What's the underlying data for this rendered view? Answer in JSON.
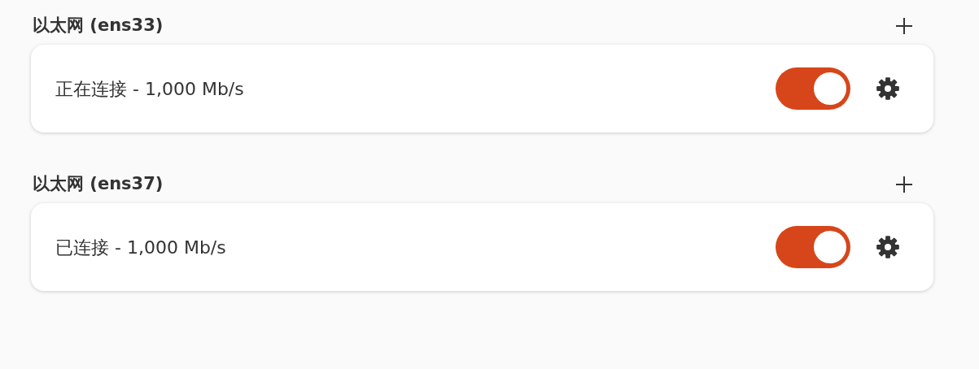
{
  "sections": [
    {
      "title": "以太网 (ens33)",
      "connection": {
        "status": "正在连接 - 1,000 Mb/s",
        "on": true
      }
    },
    {
      "title": "以太网 (ens37)",
      "connection": {
        "status": "已连接 - 1,000 Mb/s",
        "on": true
      }
    }
  ]
}
